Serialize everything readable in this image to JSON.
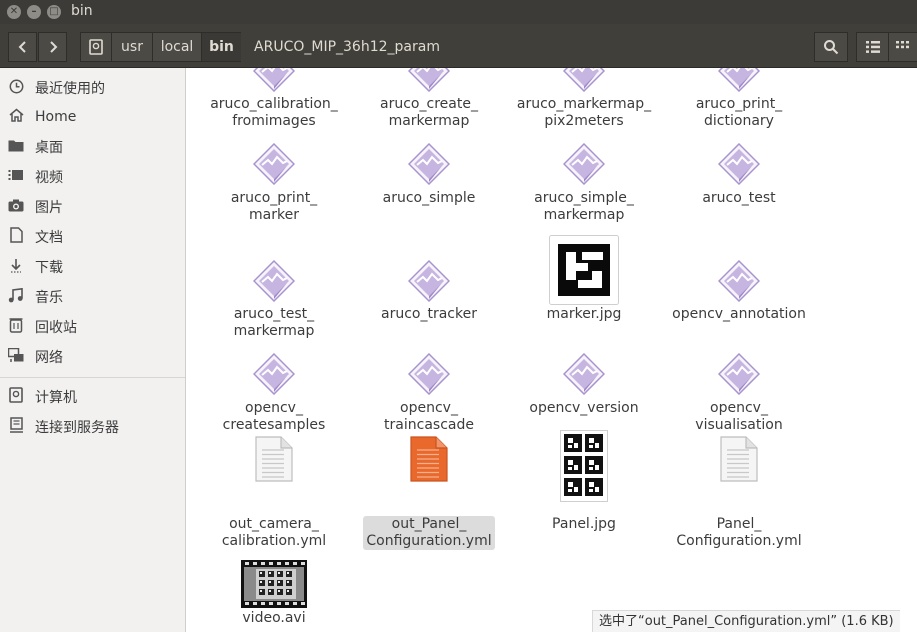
{
  "window": {
    "title": "bin"
  },
  "toolbar": {
    "breadcrumbs": [
      "usr",
      "local",
      "bin",
      "ARUCO_MIP_36h12_param"
    ]
  },
  "sidebar": {
    "items": [
      {
        "label": "最近使用的",
        "icon": "clock-icon"
      },
      {
        "label": "Home",
        "icon": "home-icon"
      },
      {
        "label": "桌面",
        "icon": "folder-icon"
      },
      {
        "label": "视频",
        "icon": "video-icon"
      },
      {
        "label": "图片",
        "icon": "camera-icon"
      },
      {
        "label": "文档",
        "icon": "document-icon"
      },
      {
        "label": "下载",
        "icon": "download-icon"
      },
      {
        "label": "音乐",
        "icon": "music-icon"
      },
      {
        "label": "回收站",
        "icon": "trash-icon"
      },
      {
        "label": "网络",
        "icon": "network-icon"
      },
      {
        "label": "计算机",
        "icon": "computer-icon"
      },
      {
        "label": "连接到服务器",
        "icon": "server-icon"
      }
    ]
  },
  "files": [
    {
      "name": "aruco_calibration_\nfromimages",
      "icon": "executable-icon"
    },
    {
      "name": "aruco_create_\nmarkermap",
      "icon": "executable-icon"
    },
    {
      "name": "aruco_markermap_\npix2meters",
      "icon": "executable-icon"
    },
    {
      "name": "aruco_print_\ndictionary",
      "icon": "executable-icon"
    },
    {
      "name": "aruco_print_\nmarker",
      "icon": "executable-icon"
    },
    {
      "name": "aruco_simple",
      "icon": "executable-icon"
    },
    {
      "name": "aruco_simple_\nmarkermap",
      "icon": "executable-icon"
    },
    {
      "name": "aruco_test",
      "icon": "executable-icon"
    },
    {
      "name": "aruco_test_\nmarkermap",
      "icon": "executable-icon"
    },
    {
      "name": "aruco_tracker",
      "icon": "executable-icon"
    },
    {
      "name": "marker.jpg",
      "icon": "marker-image-icon"
    },
    {
      "name": "opencv_annotation",
      "icon": "executable-icon"
    },
    {
      "name": "opencv_\ncreatesamples",
      "icon": "executable-icon"
    },
    {
      "name": "opencv_\ntraincascade",
      "icon": "executable-icon"
    },
    {
      "name": "opencv_version",
      "icon": "executable-icon"
    },
    {
      "name": "opencv_\nvisualisation",
      "icon": "executable-icon"
    },
    {
      "name": "out_camera_\ncalibration.yml",
      "icon": "text-file-icon"
    },
    {
      "name": "out_Panel_\nConfiguration.yml",
      "icon": "text-file-selected-icon",
      "selected": true
    },
    {
      "name": "Panel.jpg",
      "icon": "panel-image-icon"
    },
    {
      "name": "Panel_\nConfiguration.yml",
      "icon": "text-file-icon"
    },
    {
      "name": "video.avi",
      "icon": "video-file-icon"
    }
  ],
  "status": {
    "text": "选中了“out_Panel_Configuration.yml” (1.6 KB)"
  },
  "colors": {
    "titlebar": "#3c3b37",
    "toolbar": "#403f3a",
    "sidebar": "#f2f1f0",
    "selected_file": "#e9692c",
    "exec_icon": "#b9a6d6"
  }
}
